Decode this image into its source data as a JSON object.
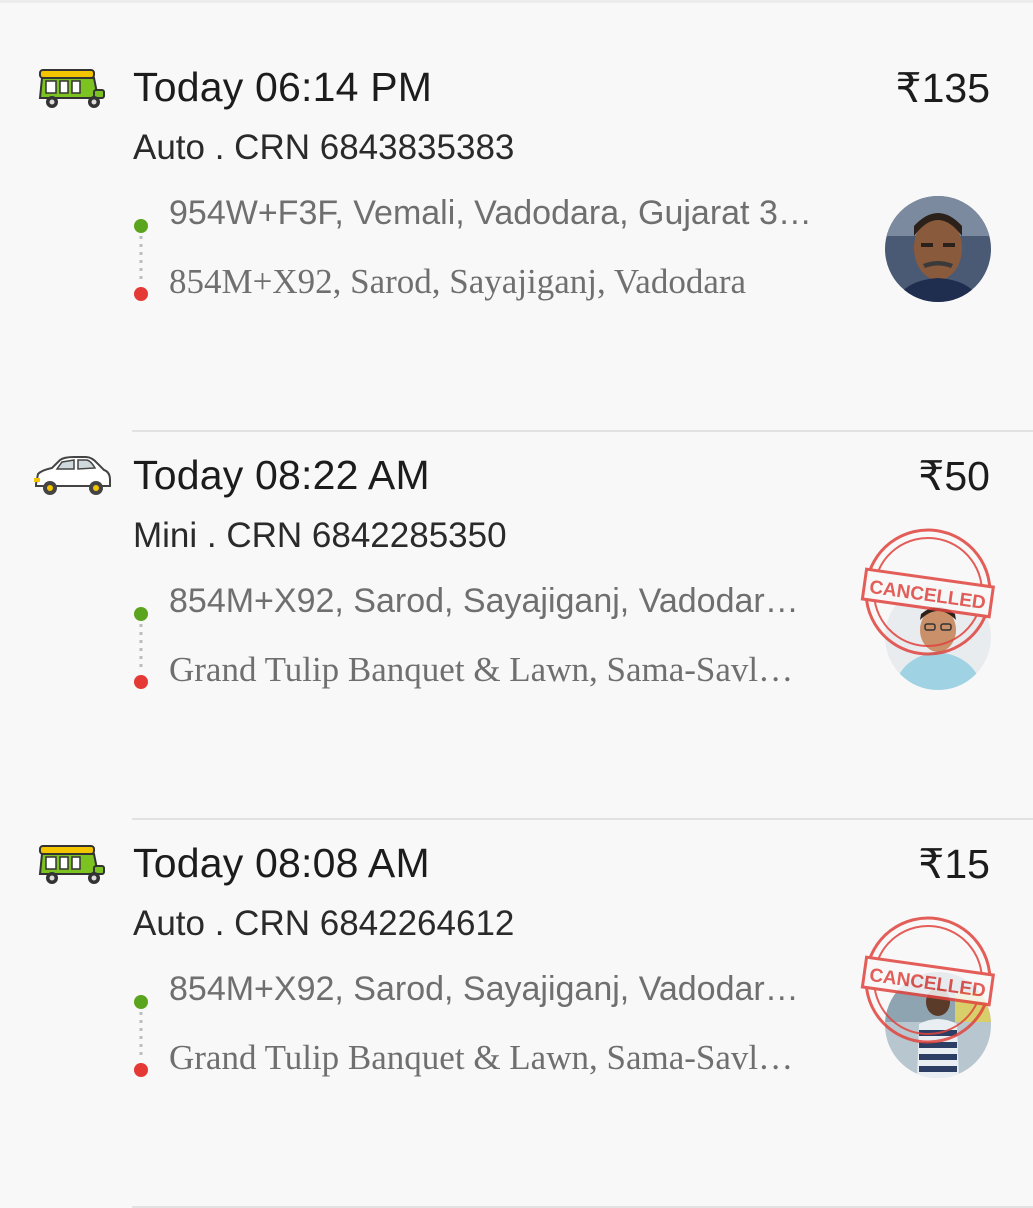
{
  "rides": [
    {
      "vehicle_icon": "auto-rickshaw-icon",
      "time": "Today 06:14 PM",
      "fare": "₹135",
      "detail": "Auto . CRN 6843835383",
      "pickup": "954W+F3F, Vemali, Vadodara, Gujarat 3…",
      "drop": "854M+X92, Sarod, Sayajiganj, Vadodara",
      "cancelled": false
    },
    {
      "vehicle_icon": "car-icon",
      "time": "Today 08:22 AM",
      "fare": "₹50",
      "detail": "Mini . CRN 6842285350",
      "pickup": "854M+X92, Sarod, Sayajiganj, Vadodar…",
      "drop": "Grand Tulip Banquet & Lawn, Sama-Savl…",
      "cancelled": true,
      "stamp_text": "CANCELLED"
    },
    {
      "vehicle_icon": "auto-rickshaw-icon",
      "time": "Today 08:08 AM",
      "fare": "₹15",
      "detail": "Auto . CRN 6842264612",
      "pickup": "854M+X92, Sarod, Sayajiganj, Vadodar…",
      "drop": "Grand Tulip Banquet & Lawn, Sama-Savl…",
      "cancelled": true,
      "stamp_text": "CANCELLED"
    }
  ],
  "colors": {
    "pickup_dot": "#5aa41e",
    "drop_dot": "#e53935",
    "stamp": "#e0443e",
    "auto_body": "#7cc321",
    "auto_roof": "#f3c400"
  }
}
